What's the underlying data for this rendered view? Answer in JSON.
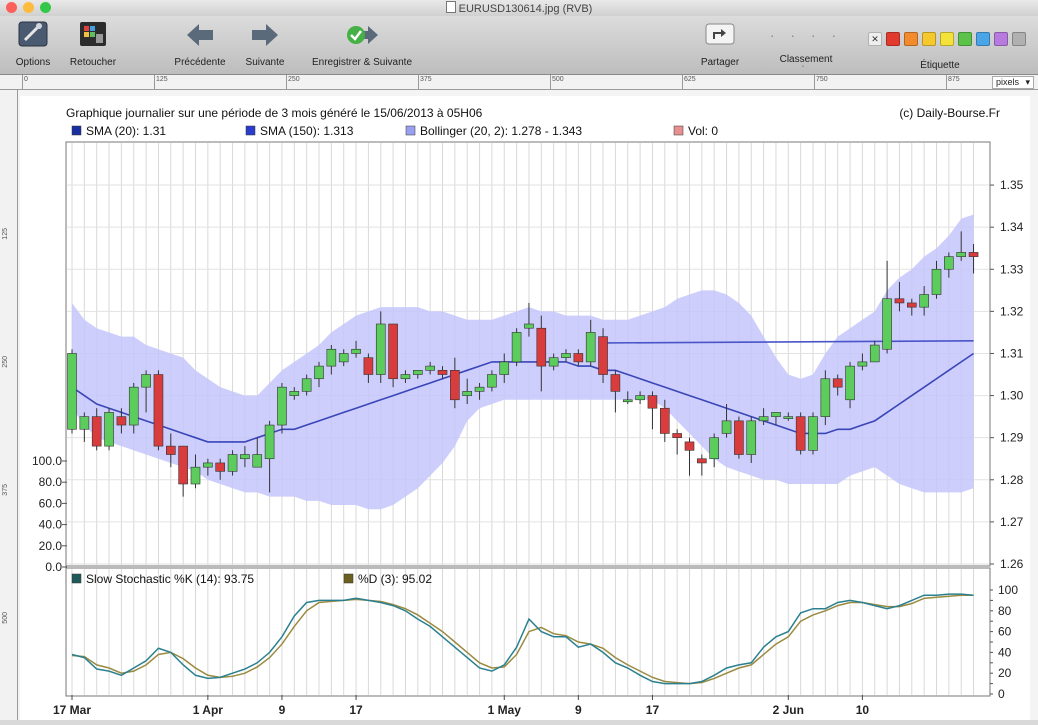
{
  "window": {
    "title": "EURUSD130614.jpg (RVB)",
    "lights": [
      "#fc605c",
      "#fdbc40",
      "#34c84a"
    ]
  },
  "toolbar": {
    "left_buttons": [
      {
        "label": "Options",
        "icon": "options-icon"
      },
      {
        "label": "Retoucher",
        "icon": "retouch-icon"
      },
      {
        "label": "Précédente",
        "icon": "arrow-left-icon"
      },
      {
        "label": "Suivante",
        "icon": "arrow-right-icon"
      },
      {
        "label": "Enregistrer & Suivante",
        "icon": "save-next-icon"
      }
    ],
    "share_label": "Partager",
    "rank_label": "Classement",
    "tag_label": "Étiquette",
    "tag_colors": [
      "#e23b2e",
      "#f28a2e",
      "#f5c92d",
      "#f2e23a",
      "#5cc24a",
      "#4aa5e8",
      "#b77be0",
      "#b0b0b0"
    ]
  },
  "ruler": {
    "ticks": [
      "0",
      "125",
      "250",
      "375",
      "500",
      "625",
      "750",
      "875"
    ],
    "unit": "pixels",
    "vticks": [
      "125",
      "250",
      "375",
      "500"
    ]
  },
  "chart_data": {
    "type": "candlestick",
    "title": "Graphique journalier sur une période de 3 mois généré le 15/06/2013 à 05H06",
    "source": "(c) Daily-Bourse.Fr",
    "legend": [
      {
        "label": "SMA (20): 1.31",
        "color": "#1a2fa0"
      },
      {
        "label": "SMA (150): 1.313",
        "color": "#2a3ccc"
      },
      {
        "label": "Bollinger (20, 2): 1.278 - 1.343",
        "color": "#9aa0f0"
      },
      {
        "label": "Vol: 0",
        "color": "#e89090"
      }
    ],
    "yticks": [
      1.26,
      1.27,
      1.28,
      1.29,
      1.3,
      1.31,
      1.32,
      1.33,
      1.34,
      1.35
    ],
    "ylim": [
      1.26,
      1.355
    ],
    "volume_ticks": [
      "100.0",
      "80.0",
      "60.0",
      "40.0",
      "20.0",
      "0.0"
    ],
    "xtick_labels": [
      {
        "label": "17 Mar",
        "i": 0
      },
      {
        "label": "1 Apr",
        "i": 11
      },
      {
        "label": "9",
        "i": 17
      },
      {
        "label": "17",
        "i": 23
      },
      {
        "label": "1 May",
        "i": 35
      },
      {
        "label": "9",
        "i": 41
      },
      {
        "label": "17",
        "i": 47
      },
      {
        "label": "2 Jun",
        "i": 58
      },
      {
        "label": "10",
        "i": 64
      }
    ],
    "candles": [
      {
        "o": 1.292,
        "h": 1.311,
        "l": 1.291,
        "c": 1.31
      },
      {
        "o": 1.292,
        "h": 1.296,
        "l": 1.289,
        "c": 1.295
      },
      {
        "o": 1.295,
        "h": 1.297,
        "l": 1.287,
        "c": 1.288
      },
      {
        "o": 1.288,
        "h": 1.297,
        "l": 1.287,
        "c": 1.296
      },
      {
        "o": 1.295,
        "h": 1.297,
        "l": 1.291,
        "c": 1.293
      },
      {
        "o": 1.293,
        "h": 1.303,
        "l": 1.291,
        "c": 1.302
      },
      {
        "o": 1.302,
        "h": 1.306,
        "l": 1.296,
        "c": 1.305
      },
      {
        "o": 1.305,
        "h": 1.306,
        "l": 1.287,
        "c": 1.288
      },
      {
        "o": 1.288,
        "h": 1.291,
        "l": 1.283,
        "c": 1.286
      },
      {
        "o": 1.288,
        "h": 1.288,
        "l": 1.276,
        "c": 1.279
      },
      {
        "o": 1.279,
        "h": 1.286,
        "l": 1.278,
        "c": 1.283
      },
      {
        "o": 1.283,
        "h": 1.285,
        "l": 1.281,
        "c": 1.284
      },
      {
        "o": 1.284,
        "h": 1.285,
        "l": 1.28,
        "c": 1.282
      },
      {
        "o": 1.282,
        "h": 1.287,
        "l": 1.281,
        "c": 1.286
      },
      {
        "o": 1.285,
        "h": 1.288,
        "l": 1.283,
        "c": 1.286
      },
      {
        "o": 1.283,
        "h": 1.29,
        "l": 1.283,
        "c": 1.286
      },
      {
        "o": 1.285,
        "h": 1.294,
        "l": 1.277,
        "c": 1.293
      },
      {
        "o": 1.293,
        "h": 1.303,
        "l": 1.291,
        "c": 1.302
      },
      {
        "o": 1.3,
        "h": 1.302,
        "l": 1.299,
        "c": 1.301
      },
      {
        "o": 1.301,
        "h": 1.305,
        "l": 1.3,
        "c": 1.304
      },
      {
        "o": 1.304,
        "h": 1.308,
        "l": 1.302,
        "c": 1.307
      },
      {
        "o": 1.307,
        "h": 1.312,
        "l": 1.305,
        "c": 1.311
      },
      {
        "o": 1.308,
        "h": 1.311,
        "l": 1.307,
        "c": 1.31
      },
      {
        "o": 1.31,
        "h": 1.313,
        "l": 1.309,
        "c": 1.311
      },
      {
        "o": 1.309,
        "h": 1.31,
        "l": 1.303,
        "c": 1.305
      },
      {
        "o": 1.305,
        "h": 1.32,
        "l": 1.303,
        "c": 1.317
      },
      {
        "o": 1.317,
        "h": 1.317,
        "l": 1.302,
        "c": 1.304
      },
      {
        "o": 1.304,
        "h": 1.306,
        "l": 1.303,
        "c": 1.305
      },
      {
        "o": 1.305,
        "h": 1.306,
        "l": 1.304,
        "c": 1.306
      },
      {
        "o": 1.306,
        "h": 1.308,
        "l": 1.305,
        "c": 1.307
      },
      {
        "o": 1.306,
        "h": 1.307,
        "l": 1.304,
        "c": 1.305
      },
      {
        "o": 1.306,
        "h": 1.309,
        "l": 1.297,
        "c": 1.299
      },
      {
        "o": 1.3,
        "h": 1.304,
        "l": 1.298,
        "c": 1.301
      },
      {
        "o": 1.301,
        "h": 1.303,
        "l": 1.299,
        "c": 1.302
      },
      {
        "o": 1.302,
        "h": 1.306,
        "l": 1.301,
        "c": 1.305
      },
      {
        "o": 1.305,
        "h": 1.31,
        "l": 1.303,
        "c": 1.308
      },
      {
        "o": 1.308,
        "h": 1.316,
        "l": 1.307,
        "c": 1.315
      },
      {
        "o": 1.316,
        "h": 1.322,
        "l": 1.314,
        "c": 1.317
      },
      {
        "o": 1.316,
        "h": 1.319,
        "l": 1.301,
        "c": 1.307
      },
      {
        "o": 1.307,
        "h": 1.31,
        "l": 1.306,
        "c": 1.309
      },
      {
        "o": 1.309,
        "h": 1.311,
        "l": 1.308,
        "c": 1.31
      },
      {
        "o": 1.31,
        "h": 1.311,
        "l": 1.307,
        "c": 1.308
      },
      {
        "o": 1.308,
        "h": 1.318,
        "l": 1.307,
        "c": 1.315
      },
      {
        "o": 1.314,
        "h": 1.316,
        "l": 1.303,
        "c": 1.305
      },
      {
        "o": 1.305,
        "h": 1.306,
        "l": 1.296,
        "c": 1.301
      },
      {
        "o": 1.299,
        "h": 1.301,
        "l": 1.298,
        "c": 1.299
      },
      {
        "o": 1.299,
        "h": 1.301,
        "l": 1.298,
        "c": 1.3
      },
      {
        "o": 1.3,
        "h": 1.301,
        "l": 1.292,
        "c": 1.297
      },
      {
        "o": 1.297,
        "h": 1.299,
        "l": 1.289,
        "c": 1.291
      },
      {
        "o": 1.291,
        "h": 1.292,
        "l": 1.286,
        "c": 1.29
      },
      {
        "o": 1.289,
        "h": 1.29,
        "l": 1.281,
        "c": 1.287
      },
      {
        "o": 1.285,
        "h": 1.286,
        "l": 1.281,
        "c": 1.284
      },
      {
        "o": 1.285,
        "h": 1.291,
        "l": 1.283,
        "c": 1.29
      },
      {
        "o": 1.291,
        "h": 1.298,
        "l": 1.29,
        "c": 1.294
      },
      {
        "o": 1.294,
        "h": 1.295,
        "l": 1.285,
        "c": 1.286
      },
      {
        "o": 1.286,
        "h": 1.295,
        "l": 1.284,
        "c": 1.294
      },
      {
        "o": 1.294,
        "h": 1.297,
        "l": 1.293,
        "c": 1.295
      },
      {
        "o": 1.295,
        "h": 1.296,
        "l": 1.293,
        "c": 1.296
      },
      {
        "o": 1.295,
        "h": 1.296,
        "l": 1.294,
        "c": 1.295
      },
      {
        "o": 1.295,
        "h": 1.296,
        "l": 1.286,
        "c": 1.287
      },
      {
        "o": 1.287,
        "h": 1.296,
        "l": 1.286,
        "c": 1.295
      },
      {
        "o": 1.295,
        "h": 1.306,
        "l": 1.293,
        "c": 1.304
      },
      {
        "o": 1.304,
        "h": 1.305,
        "l": 1.3,
        "c": 1.302
      },
      {
        "o": 1.299,
        "h": 1.308,
        "l": 1.297,
        "c": 1.307
      },
      {
        "o": 1.307,
        "h": 1.31,
        "l": 1.306,
        "c": 1.308
      },
      {
        "o": 1.308,
        "h": 1.313,
        "l": 1.308,
        "c": 1.312
      },
      {
        "o": 1.311,
        "h": 1.332,
        "l": 1.31,
        "c": 1.323
      },
      {
        "o": 1.323,
        "h": 1.327,
        "l": 1.32,
        "c": 1.322
      },
      {
        "o": 1.322,
        "h": 1.323,
        "l": 1.319,
        "c": 1.321
      },
      {
        "o": 1.321,
        "h": 1.326,
        "l": 1.319,
        "c": 1.324
      },
      {
        "o": 1.324,
        "h": 1.332,
        "l": 1.323,
        "c": 1.33
      },
      {
        "o": 1.33,
        "h": 1.334,
        "l": 1.328,
        "c": 1.333
      },
      {
        "o": 1.333,
        "h": 1.339,
        "l": 1.332,
        "c": 1.334
      },
      {
        "o": 1.334,
        "h": 1.336,
        "l": 1.329,
        "c": 1.333
      }
    ],
    "bollinger_upper": [
      1.322,
      1.318,
      1.316,
      1.315,
      1.314,
      1.314,
      1.312,
      1.311,
      1.31,
      1.309,
      1.306,
      1.304,
      1.302,
      1.301,
      1.3,
      1.3,
      1.303,
      1.306,
      1.308,
      1.31,
      1.312,
      1.315,
      1.317,
      1.319,
      1.32,
      1.321,
      1.321,
      1.321,
      1.321,
      1.32,
      1.32,
      1.319,
      1.318,
      1.318,
      1.318,
      1.319,
      1.32,
      1.321,
      1.32,
      1.32,
      1.319,
      1.319,
      1.319,
      1.318,
      1.318,
      1.318,
      1.319,
      1.32,
      1.321,
      1.323,
      1.324,
      1.325,
      1.325,
      1.324,
      1.322,
      1.319,
      1.314,
      1.309,
      1.305,
      1.304,
      1.305,
      1.31,
      1.314,
      1.316,
      1.318,
      1.32,
      1.325,
      1.328,
      1.33,
      1.333,
      1.335,
      1.338,
      1.342,
      1.343
    ],
    "bollinger_lower": [
      1.297,
      1.293,
      1.29,
      1.289,
      1.288,
      1.287,
      1.286,
      1.285,
      1.284,
      1.283,
      1.282,
      1.28,
      1.279,
      1.278,
      1.277,
      1.277,
      1.276,
      1.276,
      1.276,
      1.275,
      1.275,
      1.274,
      1.274,
      1.274,
      1.273,
      1.273,
      1.274,
      1.276,
      1.278,
      1.281,
      1.284,
      1.288,
      1.294,
      1.297,
      1.298,
      1.299,
      1.299,
      1.299,
      1.299,
      1.299,
      1.299,
      1.299,
      1.299,
      1.299,
      1.299,
      1.299,
      1.299,
      1.299,
      1.297,
      1.294,
      1.291,
      1.288,
      1.285,
      1.283,
      1.282,
      1.281,
      1.28,
      1.28,
      1.279,
      1.279,
      1.279,
      1.279,
      1.279,
      1.281,
      1.282,
      1.283,
      1.281,
      1.279,
      1.278,
      1.277,
      1.277,
      1.277,
      1.277,
      1.278
    ],
    "sma20": [
      1.302,
      1.3,
      1.298,
      1.297,
      1.296,
      1.295,
      1.294,
      1.293,
      1.292,
      1.291,
      1.29,
      1.289,
      1.289,
      1.289,
      1.289,
      1.29,
      1.291,
      1.292,
      1.292,
      1.293,
      1.294,
      1.295,
      1.296,
      1.297,
      1.298,
      1.299,
      1.3,
      1.301,
      1.302,
      1.303,
      1.304,
      1.305,
      1.306,
      1.307,
      1.308,
      1.308,
      1.308,
      1.308,
      1.308,
      1.308,
      1.308,
      1.307,
      1.307,
      1.306,
      1.306,
      1.305,
      1.304,
      1.303,
      1.302,
      1.301,
      1.3,
      1.299,
      1.298,
      1.297,
      1.296,
      1.295,
      1.294,
      1.293,
      1.292,
      1.291,
      1.291,
      1.291,
      1.292,
      1.292,
      1.293,
      1.294,
      1.296,
      1.298,
      1.3,
      1.302,
      1.304,
      1.306,
      1.308,
      1.31
    ],
    "sma150": {
      "from": 43,
      "to": 73,
      "values": [
        1.3125,
        1.313
      ]
    },
    "stochastic": {
      "label_k": "Slow Stochastic %K (14): 93.75",
      "label_d": "%D (3): 95.02",
      "color_k": "#2a8090",
      "color_d": "#9a8a40",
      "yticks": [
        0,
        10,
        20,
        30,
        40,
        50,
        60,
        70,
        80,
        90,
        100
      ],
      "k": [
        38,
        35,
        24,
        22,
        18,
        25,
        32,
        44,
        40,
        28,
        18,
        15,
        16,
        20,
        24,
        30,
        40,
        55,
        75,
        88,
        90,
        90,
        90,
        92,
        90,
        88,
        85,
        80,
        72,
        65,
        55,
        45,
        35,
        25,
        22,
        28,
        45,
        72,
        60,
        55,
        55,
        45,
        48,
        40,
        30,
        25,
        18,
        12,
        10,
        10,
        10,
        12,
        18,
        25,
        28,
        30,
        45,
        55,
        60,
        78,
        82,
        82,
        88,
        90,
        88,
        85,
        82,
        85,
        90,
        95,
        95,
        96,
        96,
        95
      ],
      "d": [
        37,
        36,
        28,
        25,
        20,
        22,
        28,
        38,
        40,
        34,
        25,
        18,
        16,
        17,
        20,
        26,
        35,
        48,
        65,
        80,
        88,
        89,
        90,
        91,
        90,
        89,
        86,
        82,
        76,
        68,
        60,
        50,
        40,
        30,
        25,
        26,
        38,
        60,
        64,
        58,
        56,
        50,
        48,
        44,
        35,
        28,
        22,
        16,
        12,
        11,
        10,
        11,
        15,
        20,
        25,
        28,
        38,
        48,
        55,
        70,
        76,
        80,
        85,
        88,
        88,
        86,
        84,
        84,
        87,
        92,
        93,
        94,
        95,
        95
      ]
    }
  }
}
